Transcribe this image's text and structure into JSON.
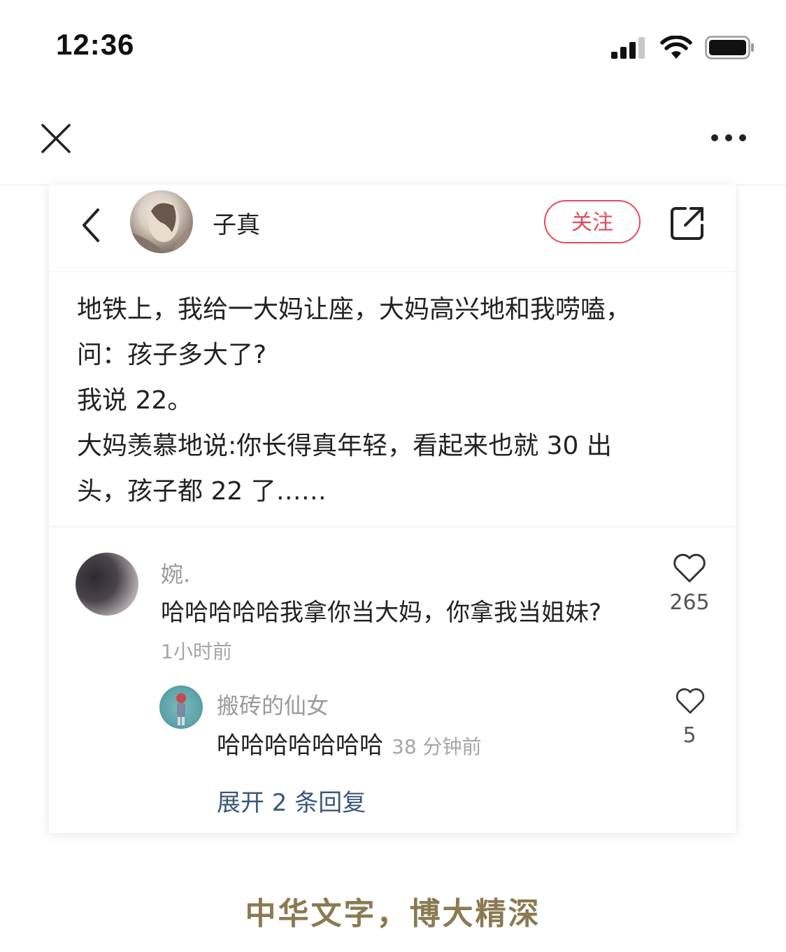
{
  "status_bar": {
    "time": "12:36",
    "icons": [
      "signal-icon",
      "wifi-icon",
      "battery-icon"
    ]
  },
  "nav": {
    "close_icon": "close-icon",
    "more_icon": "more-icon"
  },
  "post": {
    "author": "子真",
    "follow_label": "关注",
    "accent_color": "#e34b59",
    "lines": [
      "地铁上，我给一大妈让座，大妈高兴地和我唠嗑，",
      "问：孩子多大了?",
      "我说 22。",
      "大妈羡慕地说:你长得真年轻，看起来也就 30 出",
      "头，孩子都 22 了……"
    ]
  },
  "comment": {
    "name": "婉.",
    "text": "哈哈哈哈哈我拿你当大妈，你拿我当姐妹?",
    "time": "1小时前",
    "likes": "265",
    "reply": {
      "name": "搬砖的仙女",
      "text": "哈哈哈哈哈哈哈",
      "time": "38 分钟前",
      "likes": "5"
    },
    "expand_label": "展开 2 条回复"
  },
  "caption": "中华文字，博大精深"
}
